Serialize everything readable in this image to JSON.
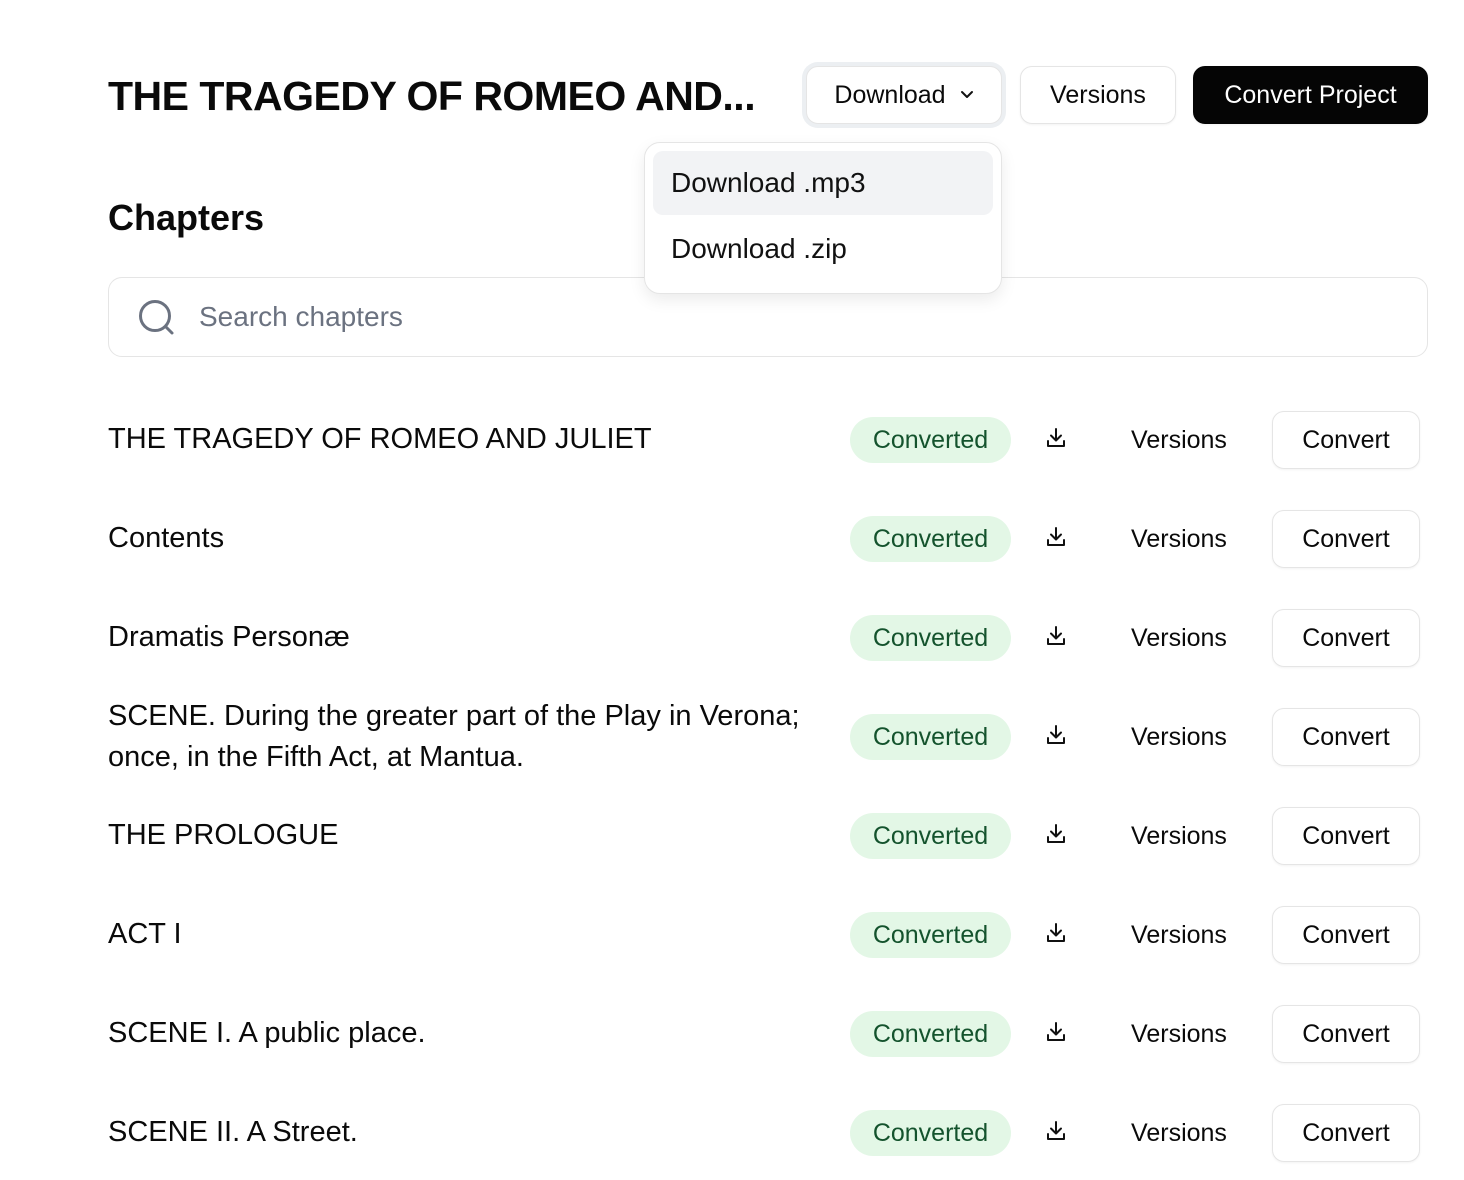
{
  "header": {
    "project_title": "THE TRAGEDY OF ROMEO AND...",
    "download_label": "Download",
    "versions_label": "Versions",
    "convert_project_label": "Convert Project"
  },
  "download_menu": {
    "items": [
      {
        "label": "Download .mp3",
        "highlighted": true
      },
      {
        "label": "Download .zip",
        "highlighted": false
      }
    ]
  },
  "chapters": {
    "heading": "Chapters",
    "search": {
      "placeholder": "Search chapters",
      "value": ""
    },
    "rows": [
      {
        "title": "THE TRAGEDY OF ROMEO AND JULIET",
        "status": "Converted",
        "versions_label": "Versions",
        "convert_label": "Convert"
      },
      {
        "title": "Contents",
        "status": "Converted",
        "versions_label": "Versions",
        "convert_label": "Convert"
      },
      {
        "title": "Dramatis Personæ",
        "status": "Converted",
        "versions_label": "Versions",
        "convert_label": "Convert"
      },
      {
        "title": "SCENE. During the greater part of the Play in Verona; once, in the Fifth Act, at Mantua.",
        "status": "Converted",
        "versions_label": "Versions",
        "convert_label": "Convert"
      },
      {
        "title": "THE PROLOGUE",
        "status": "Converted",
        "versions_label": "Versions",
        "convert_label": "Convert"
      },
      {
        "title": "ACT I",
        "status": "Converted",
        "versions_label": "Versions",
        "convert_label": "Convert"
      },
      {
        "title": "SCENE I. A public place.",
        "status": "Converted",
        "versions_label": "Versions",
        "convert_label": "Convert"
      },
      {
        "title": "SCENE II. A Street.",
        "status": "Converted",
        "versions_label": "Versions",
        "convert_label": "Convert"
      }
    ]
  },
  "icons": {
    "download_chevron": "chevron-down-icon",
    "search": "search-icon",
    "row_download": "download-icon"
  },
  "colors": {
    "primary_button_bg": "#050505",
    "badge_bg": "#e3f7e6",
    "badge_text": "#14532d",
    "menu_highlight": "#f2f3f5"
  }
}
